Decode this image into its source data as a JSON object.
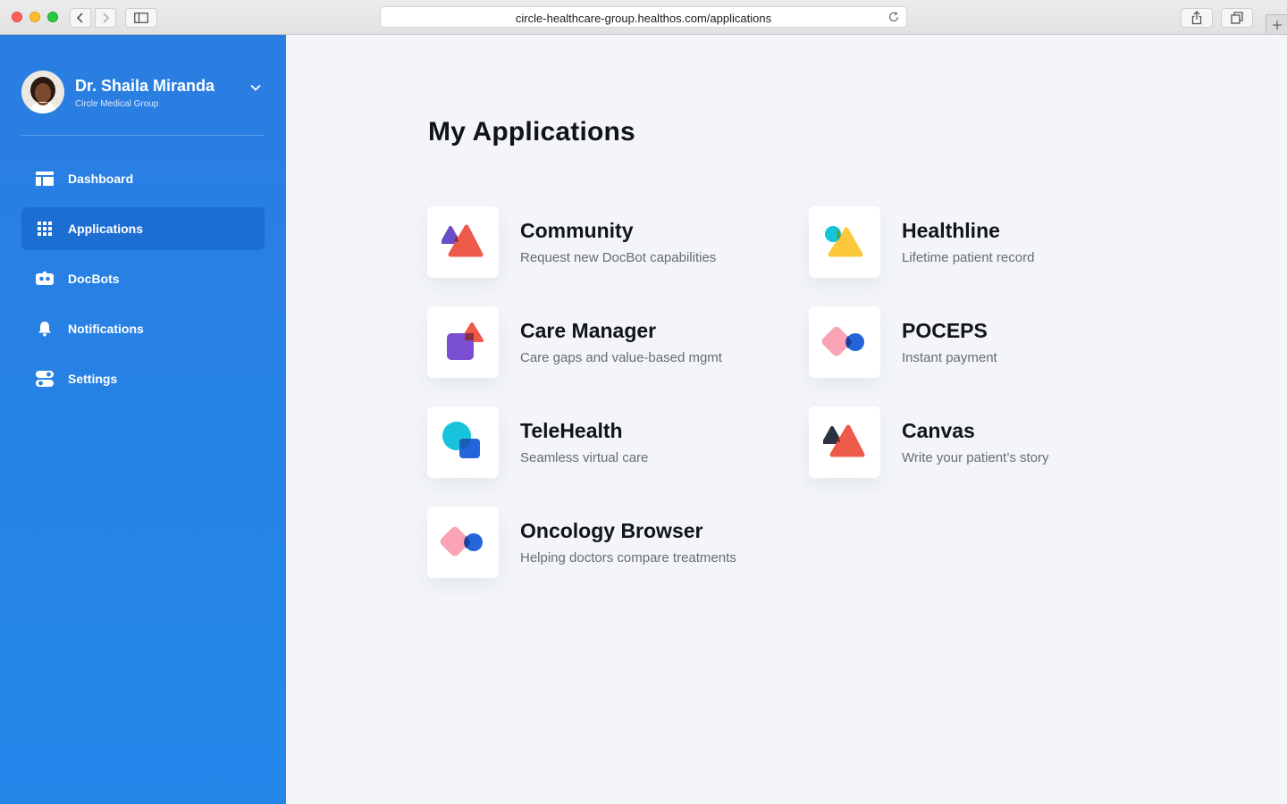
{
  "browser": {
    "url": "circle-healthcare-group.healthos.com/applications"
  },
  "profile": {
    "name": "Dr. Shaila Miranda",
    "organization": "Circle Medical Group"
  },
  "menu": [
    {
      "label": "Dashboard",
      "icon": "dashboard-icon",
      "active": false
    },
    {
      "label": "Applications",
      "icon": "grid-icon",
      "active": true
    },
    {
      "label": "DocBots",
      "icon": "robot-icon",
      "active": false
    },
    {
      "label": "Notifications",
      "icon": "bell-icon",
      "active": false
    },
    {
      "label": "Settings",
      "icon": "toggle-settings-icon",
      "active": false
    }
  ],
  "page": {
    "title": "My Applications"
  },
  "apps": [
    {
      "name": "Community",
      "description": "Request new DocBot capabilities",
      "icon": "community-logo-icon"
    },
    {
      "name": "Healthline",
      "description": "Lifetime patient record",
      "icon": "healthline-logo-icon"
    },
    {
      "name": "Care Manager",
      "description": "Care gaps and value-based mgmt",
      "icon": "care-manager-logo-icon"
    },
    {
      "name": "POCEPS",
      "description": "Instant payment",
      "icon": "poceps-logo-icon"
    },
    {
      "name": "TeleHealth",
      "description": "Seamless virtual care",
      "icon": "telehealth-logo-icon"
    },
    {
      "name": "Canvas",
      "description": "Write your patient’s story",
      "icon": "canvas-logo-icon"
    },
    {
      "name": "Oncology Browser",
      "description": "Helping doctors compare treatments",
      "icon": "oncology-browser-logo-icon"
    }
  ],
  "colors": {
    "sidebar": "#2a7de1",
    "sidebar_active": "#1d6ed3",
    "background": "#f3f5f9"
  }
}
